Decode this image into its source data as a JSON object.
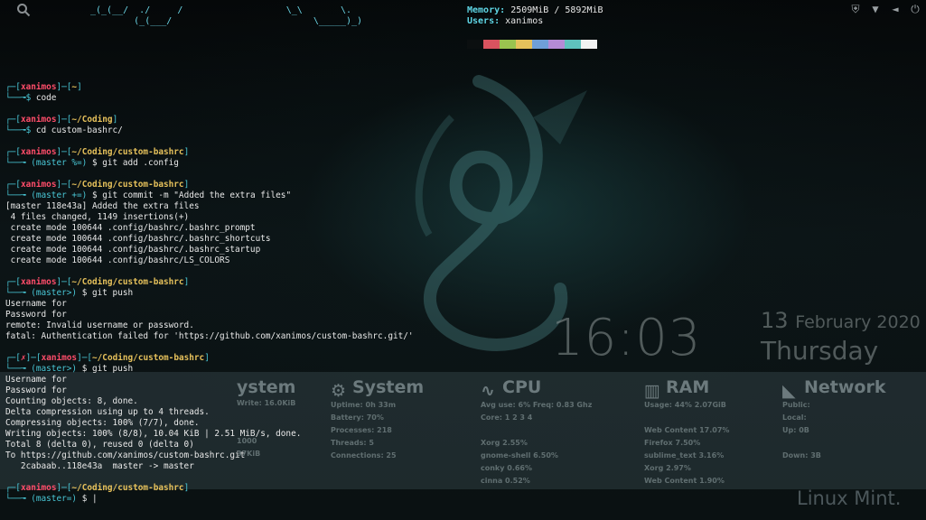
{
  "panel": {
    "left_icon": "search-icon",
    "tray_icons": [
      "shield-icon",
      "wifi-icon",
      "volume-icon",
      "power-icon"
    ]
  },
  "neofetch": {
    "ascii_line1": "_(_(__/  ./     /                   \\_\\       \\.",
    "ascii_line2": "        (_(___/                          \\_____)_)",
    "memory_label": "Memory:",
    "memory_value": "2509MiB / 5892MiB",
    "users_label": "Users:",
    "users_value": "xanimos",
    "palette": [
      "#0b0f10",
      "#d9535f",
      "#9ac34f",
      "#e6c15b",
      "#6f9fd8",
      "#b58bd6",
      "#5fc2bd",
      "#f2f2f2"
    ]
  },
  "terminal": {
    "user": "xanimos",
    "blocks": [
      {
        "path": "~",
        "prompt": "──╼$ ",
        "branch": "",
        "cmd": "code",
        "output": []
      },
      {
        "path": "~/Coding",
        "prompt": "──╼$ ",
        "branch": "",
        "cmd": "cd custom-bashrc/",
        "output": []
      },
      {
        "path": "~/Coding/custom-bashrc",
        "prompt": "──╼ ",
        "branch": "(master %=)",
        "cmd": "$ git add .config",
        "output": []
      },
      {
        "path": "~/Coding/custom-bashrc",
        "prompt": "──╼ ",
        "branch": "(master +=)",
        "cmd": "$ git commit -m \"Added the extra files\"",
        "output": [
          "[master 118e43a] Added the extra files",
          " 4 files changed, 1149 insertions(+)",
          " create mode 100644 .config/bashrc/.bashrc_prompt",
          " create mode 100644 .config/bashrc/.bashrc_shortcuts",
          " create mode 100644 .config/bashrc/.bashrc_startup",
          " create mode 100644 .config/bashrc/LS_COLORS"
        ]
      },
      {
        "path": "~/Coding/custom-bashrc",
        "prompt": "──╼ ",
        "branch": "(master>)",
        "cmd": "$ git push",
        "output": [
          "Username for",
          "Password for",
          "remote: Invalid username or password.",
          "fatal: Authentication failed for 'https://github.com/xanimos/custom-bashrc.git/'"
        ]
      },
      {
        "path": "~/Coding/custom-bashrc",
        "prompt": "──╼ ",
        "branch": "(master>)",
        "cmd": "$ git push",
        "error_mark": "✗",
        "output": [
          "Username for",
          "Password for",
          "Counting objects: 8, done.",
          "Delta compression using up to 4 threads.",
          "Compressing objects: 100% (7/7), done.",
          "Writing objects: 100% (8/8), 10.04 KiB | 2.51 MiB/s, done.",
          "Total 8 (delta 0), reused 0 (delta 0)",
          "To https://github.com/xanimos/custom-bashrc.git",
          "   2cabaab..118e43a  master -> master"
        ]
      },
      {
        "path": "~/Coding/custom-bashrc",
        "prompt": "──╼ ",
        "branch": "(master=)",
        "cmd": "$ |",
        "output": []
      }
    ]
  },
  "clock": {
    "time": "16:03",
    "day": "13",
    "month_year": "February 2020",
    "weekday": "Thursday"
  },
  "conky": {
    "sys1": {
      "title": "ystem",
      "rows": [
        "Write: 16.0KiB",
        "",
        "",
        "1000",
        "37KiB"
      ]
    },
    "sys2": {
      "title": "System",
      "rows": [
        "Uptime: 0h 33m",
        "Battery: 70%",
        "Processes: 218",
        "Threads: 5",
        "Connections: 25"
      ]
    },
    "cpu": {
      "title": "CPU",
      "rows": [
        "Avg use: 6%    Freq: 0.83 Ghz",
        "Core: 1     2     3     4",
        "",
        "Xorg                         2.55%",
        "gnome-shell                  6.50%",
        "conky                        0.66%",
        "cinna                        0.52%"
      ]
    },
    "ram": {
      "title": "RAM",
      "rows": [
        "Usage: 44%                2.07GiB",
        "",
        "Web Content             17.07%",
        "Firefox                   7.50%",
        "sublime_text             3.16%",
        "Xorg                     2.97%",
        "Web Content              1.90%"
      ]
    },
    "net": {
      "title": "Network",
      "rows": [
        "Public:",
        "Local:",
        "Up: 0B",
        "",
        "Down: 3B"
      ]
    }
  },
  "branding": {
    "text": "Linux Mint."
  }
}
